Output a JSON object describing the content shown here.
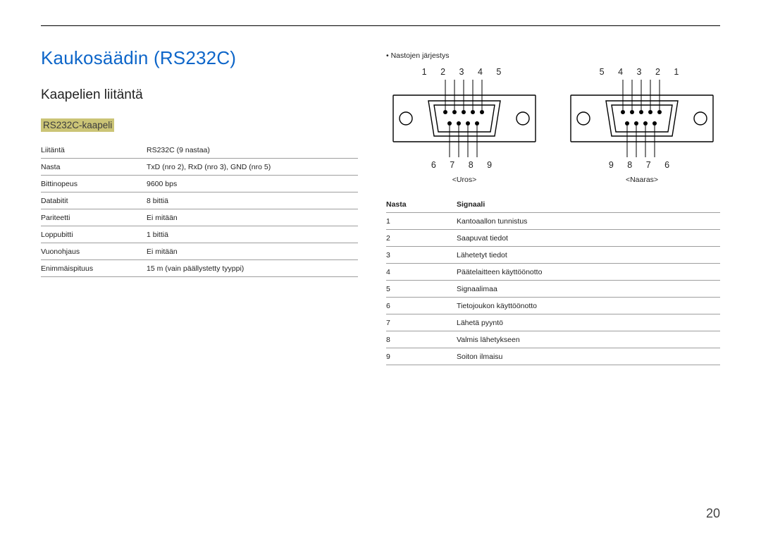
{
  "page_number": "20",
  "left": {
    "title": "Kaukosäädin (RS232C)",
    "subtitle": "Kaapelien liitäntä",
    "h3": "RS232C-kaapeli",
    "spec": [
      {
        "k": "Liitäntä",
        "v": "RS232C (9 nastaa)"
      },
      {
        "k": "Nasta",
        "v": "TxD (nro 2), RxD (nro 3), GND (nro 5)"
      },
      {
        "k": "Bittinopeus",
        "v": "9600 bps"
      },
      {
        "k": "Databitit",
        "v": "8 bittiä"
      },
      {
        "k": "Pariteetti",
        "v": "Ei mitään"
      },
      {
        "k": "Loppubitti",
        "v": "1 bittiä"
      },
      {
        "k": "Vuonohjaus",
        "v": "Ei mitään"
      },
      {
        "k": "Enimmäispituus",
        "v": "15 m (vain päällystetty tyyppi)"
      }
    ]
  },
  "right": {
    "bullet": "Nastojen järjestys",
    "connectors": {
      "male": {
        "top": "1 2 3 4 5",
        "bottom": "6 7 8 9",
        "label": "<Uros>"
      },
      "female": {
        "top": "5 4 3 2 1",
        "bottom": "9 8 7 6",
        "label": "<Naaras>"
      }
    },
    "sig_header": {
      "c1": "Nasta",
      "c2": "Signaali"
    },
    "sig": [
      {
        "n": "1",
        "s": "Kantoaallon tunnistus"
      },
      {
        "n": "2",
        "s": "Saapuvat tiedot"
      },
      {
        "n": "3",
        "s": "Lähetetyt tiedot"
      },
      {
        "n": "4",
        "s": "Päätelaitteen käyttöönotto"
      },
      {
        "n": "5",
        "s": "Signaalimaa"
      },
      {
        "n": "6",
        "s": "Tietojoukon käyttöönotto"
      },
      {
        "n": "7",
        "s": "Lähetä pyyntö"
      },
      {
        "n": "8",
        "s": "Valmis lähetykseen"
      },
      {
        "n": "9",
        "s": "Soiton ilmaisu"
      }
    ]
  }
}
